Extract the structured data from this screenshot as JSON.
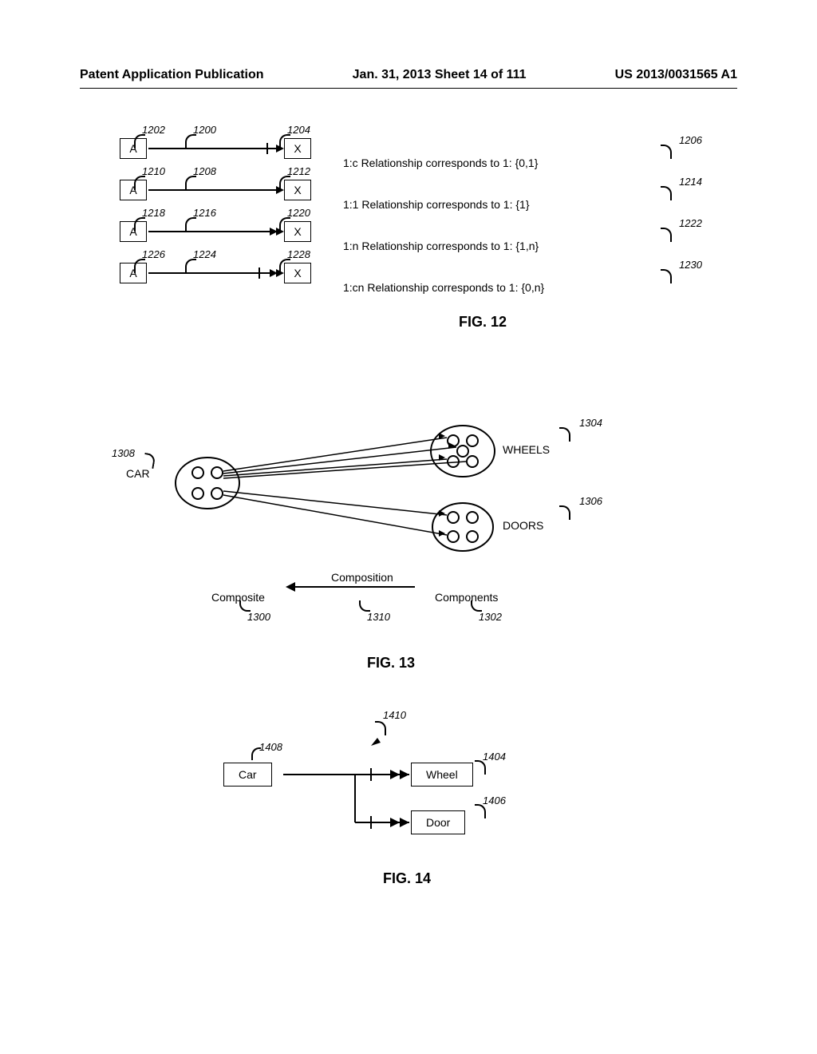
{
  "header": {
    "left": "Patent Application Publication",
    "center": "Jan. 31, 2013  Sheet 14 of 111",
    "right": "US 2013/0031565 A1"
  },
  "fig12": {
    "caption": "FIG. 12",
    "rows": [
      {
        "boxA": "A",
        "boxX": "X",
        "desc": "1:c Relationship corresponds to 1: {0,1}",
        "refA": "1202",
        "refLine": "1200",
        "refX": "1204",
        "refDesc": "1206",
        "arrowType": "single-tick"
      },
      {
        "boxA": "A",
        "boxX": "X",
        "desc": "1:1 Relationship corresponds to 1: {1}",
        "refA": "1210",
        "refLine": "1208",
        "refX": "1212",
        "refDesc": "1214",
        "arrowType": "single"
      },
      {
        "boxA": "A",
        "boxX": "X",
        "desc": "1:n Relationship corresponds to 1: {1,n}",
        "refA": "1218",
        "refLine": "1216",
        "refX": "1220",
        "refDesc": "1222",
        "arrowType": "double"
      },
      {
        "boxA": "A",
        "boxX": "X",
        "desc": "1:cn Relationship corresponds to 1: {0,n}",
        "refA": "1226",
        "refLine": "1224",
        "refX": "1228",
        "refDesc": "1230",
        "arrowType": "double-tick"
      }
    ]
  },
  "fig13": {
    "caption": "FIG. 13",
    "car": {
      "label": "CAR",
      "ref": "1308"
    },
    "wheels": {
      "label": "WHEELS",
      "ref": "1304"
    },
    "doors": {
      "label": "DOORS",
      "ref": "1306"
    },
    "composite": {
      "label": "Composite",
      "ref": "1300"
    },
    "components": {
      "label": "Components",
      "ref": "1302"
    },
    "composition": {
      "label": "Composition",
      "ref": "1310"
    }
  },
  "fig14": {
    "caption": "FIG. 14",
    "car": {
      "label": "Car",
      "ref": "1408"
    },
    "wheel": {
      "label": "Wheel",
      "ref": "1404"
    },
    "door": {
      "label": "Door",
      "ref": "1406"
    },
    "arrowRef": "1410"
  }
}
